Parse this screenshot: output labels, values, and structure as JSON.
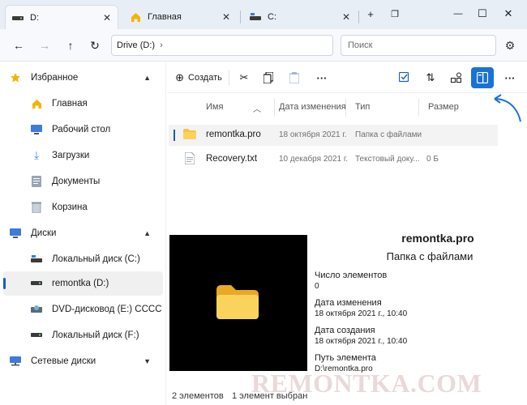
{
  "tabs": [
    {
      "label": "D:",
      "icon": "drive-icon"
    },
    {
      "label": "Главная",
      "icon": "home-icon"
    },
    {
      "label": "C:",
      "icon": "drive-icon"
    }
  ],
  "window": {
    "new_tab": "+",
    "minimize": "—",
    "maximize": "☐",
    "close": "✕"
  },
  "nav": {
    "address": "Drive (D:)",
    "search_placeholder": "Поиск"
  },
  "sidebar": {
    "favorites": {
      "label": "Избранное"
    },
    "items_fav": [
      {
        "label": "Главная",
        "icon": "home-icon"
      },
      {
        "label": "Рабочий стол",
        "icon": "desktop-icon"
      },
      {
        "label": "Загрузки",
        "icon": "download-icon"
      },
      {
        "label": "Документы",
        "icon": "document-icon"
      },
      {
        "label": "Корзина",
        "icon": "recycle-bin-icon"
      }
    ],
    "drives": {
      "label": "Диски"
    },
    "items_drives": [
      {
        "label": "Локальный диск (C:)",
        "icon": "drive-icon"
      },
      {
        "label": "remontka (D:)",
        "icon": "drive-icon"
      },
      {
        "label": "DVD-дисковод (E:) CCCC",
        "icon": "dvd-icon"
      },
      {
        "label": "Локальный диск (F:)",
        "icon": "drive-icon"
      }
    ],
    "network": {
      "label": "Сетевые диски"
    }
  },
  "toolbar": {
    "create_label": "Создать"
  },
  "columns": {
    "name": "Имя",
    "date": "Дата изменения",
    "type": "Тип",
    "size": "Размер"
  },
  "files": [
    {
      "name": "remontka.pro",
      "date": "18 октября 2021 г.",
      "type": "Папка с файлами",
      "size": "",
      "icon": "folder-icon"
    },
    {
      "name": "Recovery.txt",
      "date": "10 декабря 2021 г.",
      "type": "Текстовый доку...",
      "size": "0 Б",
      "icon": "text-file-icon"
    }
  ],
  "preview": {
    "title": "remontka.pro",
    "subtitle": "Папка с файлами",
    "count_label": "Число элементов",
    "count_value": "0",
    "modified_label": "Дата изменения",
    "modified_value": "18 октября 2021 г., 10:40",
    "created_label": "Дата создания",
    "created_value": "18 октября 2021 г., 10:40",
    "path_label": "Путь элемента",
    "path_value": "D:\\remontka.pro"
  },
  "status": {
    "count": "2 элементов",
    "selected": "1 элемент выбран"
  },
  "watermark": "REMONTKA.COM",
  "colors": {
    "accent": "#1a73d4",
    "folder": "#f5c542"
  }
}
